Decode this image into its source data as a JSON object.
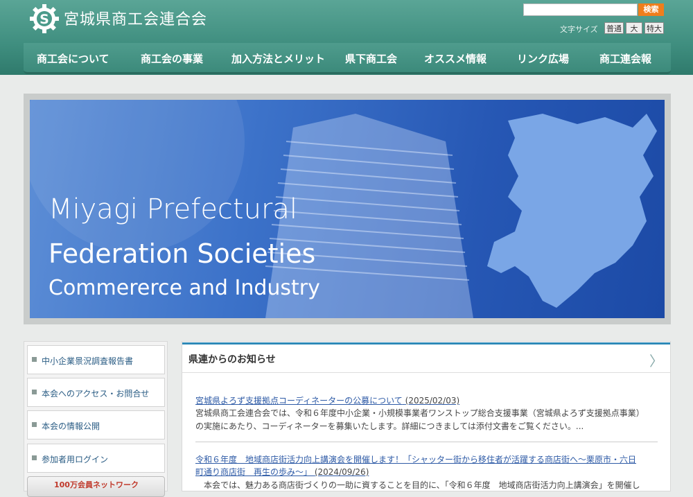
{
  "header": {
    "title": "宮城県商工会連合会",
    "logo_icon": "gear-s-logo-icon",
    "search": {
      "value": "",
      "button_label": "検索"
    },
    "font_size": {
      "label": "文字サイズ",
      "options": [
        "普通",
        "大",
        "特大"
      ]
    }
  },
  "nav": {
    "items": [
      "商工会について",
      "商工会の事業",
      "加入方法とメリット",
      "県下商工会",
      "オススメ情報",
      "リンク広場",
      "商工連会報"
    ]
  },
  "banner": {
    "line1": "Miyagi Prefectural",
    "line2": "Federation Societies",
    "line3": "Commererce and Industry"
  },
  "sidebar": {
    "items": [
      "中小企業景況調査報告書",
      "本会へのアクセス・お問合せ",
      "本会の情報公開",
      "参加者用ログイン"
    ],
    "network_label": "100万会員ネットワーク"
  },
  "news": {
    "heading": "県連からのお知らせ",
    "items": [
      {
        "title": "宮城県よろず支援拠点コーディネーターの公募について",
        "date": "(2025/02/03)",
        "body1": "宮城県商工会連合会では、令和６年度中小企業・小規模事業者ワンストップ総合支援事業（宮城県よろず支援拠点事業）",
        "body2": "の実施にあたり、コーディネーターを募集いたします。詳細につきましては添付文書をご覧ください。..."
      },
      {
        "title1": "令和６年度　地域商店街活力向上講演会を開催します！「シャッター街から移住者が活躍する商店街へ〜栗原市・六日",
        "title2": "町通り商店街　再生の歩み〜」",
        "date": "(2024/09/26)",
        "body1": "　本会では、魅力ある商店街づくりの一助に資することを目的に、「令和６年度　地域商店街活力向上講演会」を開催し"
      }
    ]
  }
}
